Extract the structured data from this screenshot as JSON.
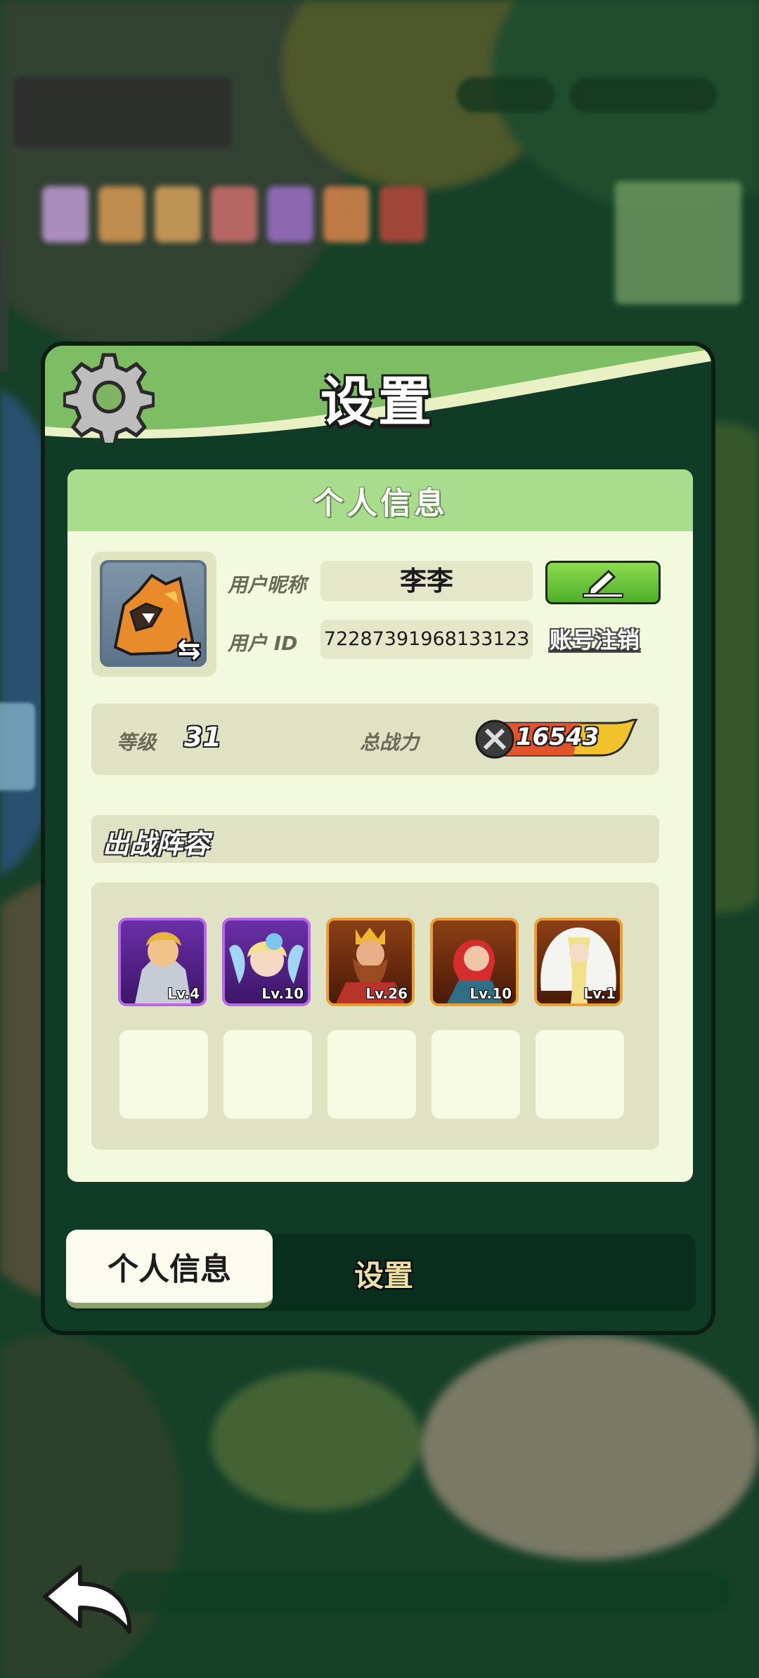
{
  "dialog": {
    "title": "设置",
    "panel_title": "个人信息"
  },
  "profile": {
    "nickname_label": "用户昵称",
    "nickname_value": "李李",
    "id_label": "用户 ID",
    "id_value": "7228739196813312З",
    "cancel_account": "账号注销"
  },
  "stats": {
    "level_label": "等级",
    "level_value": "31",
    "power_label": "总战力",
    "power_value": "16543"
  },
  "lineup": {
    "title": "出战阵容",
    "heroes": [
      {
        "level": "Lv.4",
        "rarity": "purple"
      },
      {
        "level": "Lv.10",
        "rarity": "purple"
      },
      {
        "level": "Lv.26",
        "rarity": "gold"
      },
      {
        "level": "Lv.10",
        "rarity": "gold"
      },
      {
        "level": "Lv.1",
        "rarity": "gold"
      }
    ]
  },
  "tabs": {
    "active": "个人信息",
    "inactive": "设置"
  },
  "colors": {
    "header_green": "#8cc96f",
    "panel_bg": "#f3f9dc",
    "edit_button": "#6cc43b",
    "purple_rarity": "#b767e8",
    "gold_rarity": "#e9a031"
  }
}
